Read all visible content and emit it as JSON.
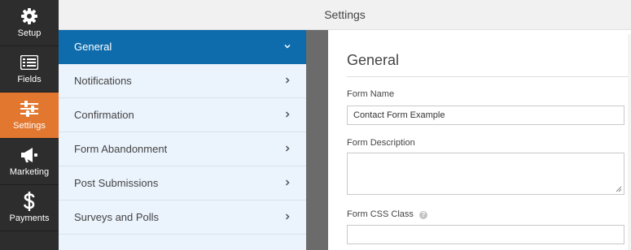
{
  "rail": {
    "items": [
      {
        "label": "Setup",
        "icon": "gear-icon"
      },
      {
        "label": "Fields",
        "icon": "list-icon"
      },
      {
        "label": "Settings",
        "icon": "sliders-icon"
      },
      {
        "label": "Marketing",
        "icon": "megaphone-icon"
      },
      {
        "label": "Payments",
        "icon": "dollar-icon"
      }
    ],
    "active": "Settings",
    "colors": {
      "background": "#2d2d2d",
      "active": "#e27730"
    }
  },
  "header": {
    "title": "Settings"
  },
  "sections": {
    "items": [
      {
        "label": "General",
        "icon": "chevron-down-icon",
        "active": true
      },
      {
        "label": "Notifications",
        "icon": "chevron-right-icon"
      },
      {
        "label": "Confirmation",
        "icon": "chevron-right-icon"
      },
      {
        "label": "Form Abandonment",
        "icon": "chevron-right-icon"
      },
      {
        "label": "Post Submissions",
        "icon": "chevron-right-icon"
      },
      {
        "label": "Surveys and Polls",
        "icon": "chevron-right-icon"
      }
    ],
    "colors": {
      "active": "#0e6cad",
      "background": "#ebf3fc"
    }
  },
  "panel": {
    "title": "General",
    "form_name": {
      "label": "Form Name",
      "value": "Contact Form Example"
    },
    "form_description": {
      "label": "Form Description",
      "value": ""
    },
    "form_css_class": {
      "label": "Form CSS Class",
      "value": "",
      "help_icon": "question-icon",
      "help_glyph": "?"
    }
  }
}
